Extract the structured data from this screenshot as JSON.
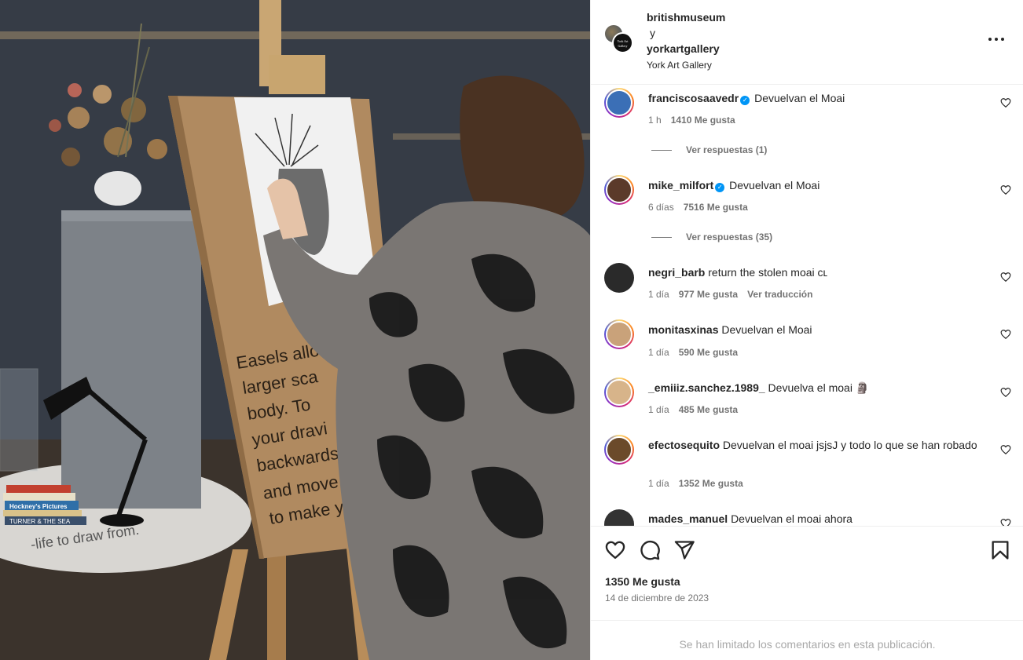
{
  "post": {
    "photo_alt_icon": "photo",
    "header": {
      "user1": "britishmuseum",
      "connector": "y",
      "user2": "yorkartgallery",
      "location": "York Art Gallery",
      "avatar2_text": "York Art Gallery"
    },
    "easel_sign_lines": [
      "Easels allo",
      "larger sca",
      "body. To",
      "your dravi",
      "backwards.",
      "and move it fr",
      "to make your m"
    ],
    "floor_text": "-life to draw from.",
    "books": [
      "Hockney's Pictures",
      "TURNER & THE SEA"
    ]
  },
  "comments": [
    {
      "user": "franciscosaavedr",
      "verified": true,
      "text": "Devuelvan el Moai",
      "time": "1 h",
      "likes": "1410 Me gusta",
      "translate": "",
      "replies": "Ver respuestas (1)",
      "avatar_color": "#3b6fb6"
    },
    {
      "user": "mike_milfort",
      "verified": true,
      "text": "Devuelvan el Moai",
      "time": "6 días",
      "likes": "7516 Me gusta",
      "translate": "",
      "replies": "Ver respuestas (35)",
      "avatar_color": "#5b3a2a"
    },
    {
      "user": "negri_barb",
      "verified": false,
      "text": "return the stolen moai ᴄʟ",
      "time": "1 día",
      "likes": "977 Me gusta",
      "translate": "Ver traducción",
      "replies": "",
      "avatar_color": "#2a2a2a"
    },
    {
      "user": "monitasxinas",
      "verified": false,
      "text": "Devuelvan el Moai",
      "time": "1 día",
      "likes": "590 Me gusta",
      "translate": "",
      "replies": "",
      "avatar_color": "#c9a27a"
    },
    {
      "user": "_emiiiz.sanchez.1989_",
      "verified": false,
      "text": "Devuelva el moai 🗿",
      "time": "1 día",
      "likes": "485 Me gusta",
      "translate": "",
      "replies": "",
      "avatar_color": "#d7b48a"
    },
    {
      "user": "efectosequito",
      "verified": false,
      "text": "Devuelvan el moai jsjsJ y todo lo que se han robado",
      "time": "1 día",
      "likes": "1352 Me gusta",
      "translate": "",
      "replies": "",
      "avatar_color": "#6b4a2a"
    },
    {
      "user": "mades_manuel",
      "verified": false,
      "text": "Devuelvan el moai ahora",
      "time": "",
      "likes": "",
      "translate": "",
      "replies": "",
      "avatar_color": "#333333"
    }
  ],
  "actions": {
    "likes": "1350 Me gusta",
    "date": "14 de diciembre de 2023"
  },
  "footer": {
    "notice": "Se han limitado los comentarios en esta publicación."
  }
}
